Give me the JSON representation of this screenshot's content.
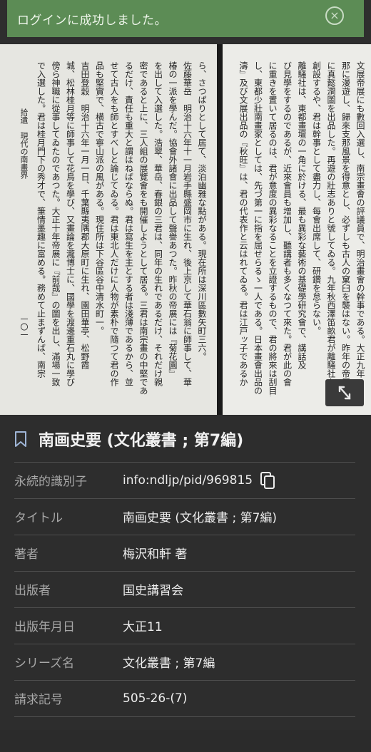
{
  "toast": {
    "message": "ログインに成功しました。",
    "close_icon": "close-circle-icon"
  },
  "scan": {
    "left_page_lines": [
      "ら、さつぱりとして居て、淡泊幽雅な點がある。現在所は深川區數矢町三六。",
      "佐藤華岳　明治十六年十一月岩手縣盛岡市に生れ、後上京して華石翁に師事して、華",
      "椿の一派を學んだ。協會外諸會に出品して聲譽あつた。昨秋の帝展には『菊花園』",
      "を出して入選した。浩翠、華岳、春銀の三君は、同年の生れであるだけ、それだけ親",
      "密であると上に、三人組の展覽會をも開催しようとして居る。三君は南宗畫の中堅であ",
      "るだけ、責任も重大と謂はねばならぬ。君は寫生を主とする者は淺薄であるから、並",
      "せて古人をも師とすべしと論じてゐる。君は東北人だけに人物が素朴で隨つて君の作",
      "品も堅實で、横古で寧山派の風がある。現住所は下谷區谷中清水町一。",
      "吉田登穀　明治十六年一月一日、千葉縣夷隅郡大原町に生れ、園田華亭、松野霞",
      "城、松林桂月等に師事して花鳥を學び、又畫論を瀧博士に、國學を渡邊重石丸に學び",
      "傍ら神職に從事してゐたのであつた。大正十年帝展に『前哉』の圖を出し、滿場一致",
      "で入選した。君は桂月門下の秀才で、筆情墨趣に富める。務めて止まずんば、南宗"
    ],
    "running_header": "拾遺　現代の南畫界",
    "page_number": "一〇一",
    "right_page_lines": [
      "文展帝展にも數回入選し、南宗畫會の評議員で、明治畫會の幹事である。大正九年",
      "那に漫遊し、歸來支那風景を得意とし、必ずしも古人の窠臼を襲はない。昨年の帝展",
      "に真懿澗圖を出品した。再遊の壯志ありと號してゐる。九年秋西澤笛畝君が離騷社を",
      "創設するや、君は幹事として盡力し、每會出席して、研鑽を怠らない。",
      "離騷社は、東都畫壇の一角に於ける、最も異彩な藝術の基礎學研究會で、講話及",
      "び見學をするのであるが、近來會員も增加し、聽講者も多くなつて來た。君が此の會",
      "に重きを置いて居るのは、君が意度の異彩なることを立證するもので、君の將來は刮目に値",
      "し、東都少壯南畫家としては、先づ第一に指を屈せらるゝ一人である。日本畫會出品の『松",
      "濤』及び文展出品の『秋旺』は、君の代表作と云はれてゐる。君は江戸ッ子であるか"
    ],
    "fullscreen_icon": "expand-arrows-icon"
  },
  "book": {
    "bookmark_icon": "bookmark-icon",
    "title": "南画史要 (文化叢書 ; 第7編)"
  },
  "metadata": [
    {
      "label": "永続的識別子",
      "value": "info:ndljp/pid/969815",
      "copy_icon": "copy-icon"
    },
    {
      "label": "タイトル",
      "value": "南画史要 (文化叢書 ; 第7編)"
    },
    {
      "label": "著者",
      "value": "梅沢和軒 著"
    },
    {
      "label": "出版者",
      "value": "国史講習会"
    },
    {
      "label": "出版年月日",
      "value": "大正11"
    },
    {
      "label": "シリーズ名",
      "value": "文化叢書 ; 第7編"
    },
    {
      "label": "請求記号",
      "value": "505-26-(7)"
    }
  ],
  "colors": {
    "toast_bg": "#5c8c55",
    "panel_bg": "#2d2d2d",
    "divider": "#4e4e4e"
  }
}
